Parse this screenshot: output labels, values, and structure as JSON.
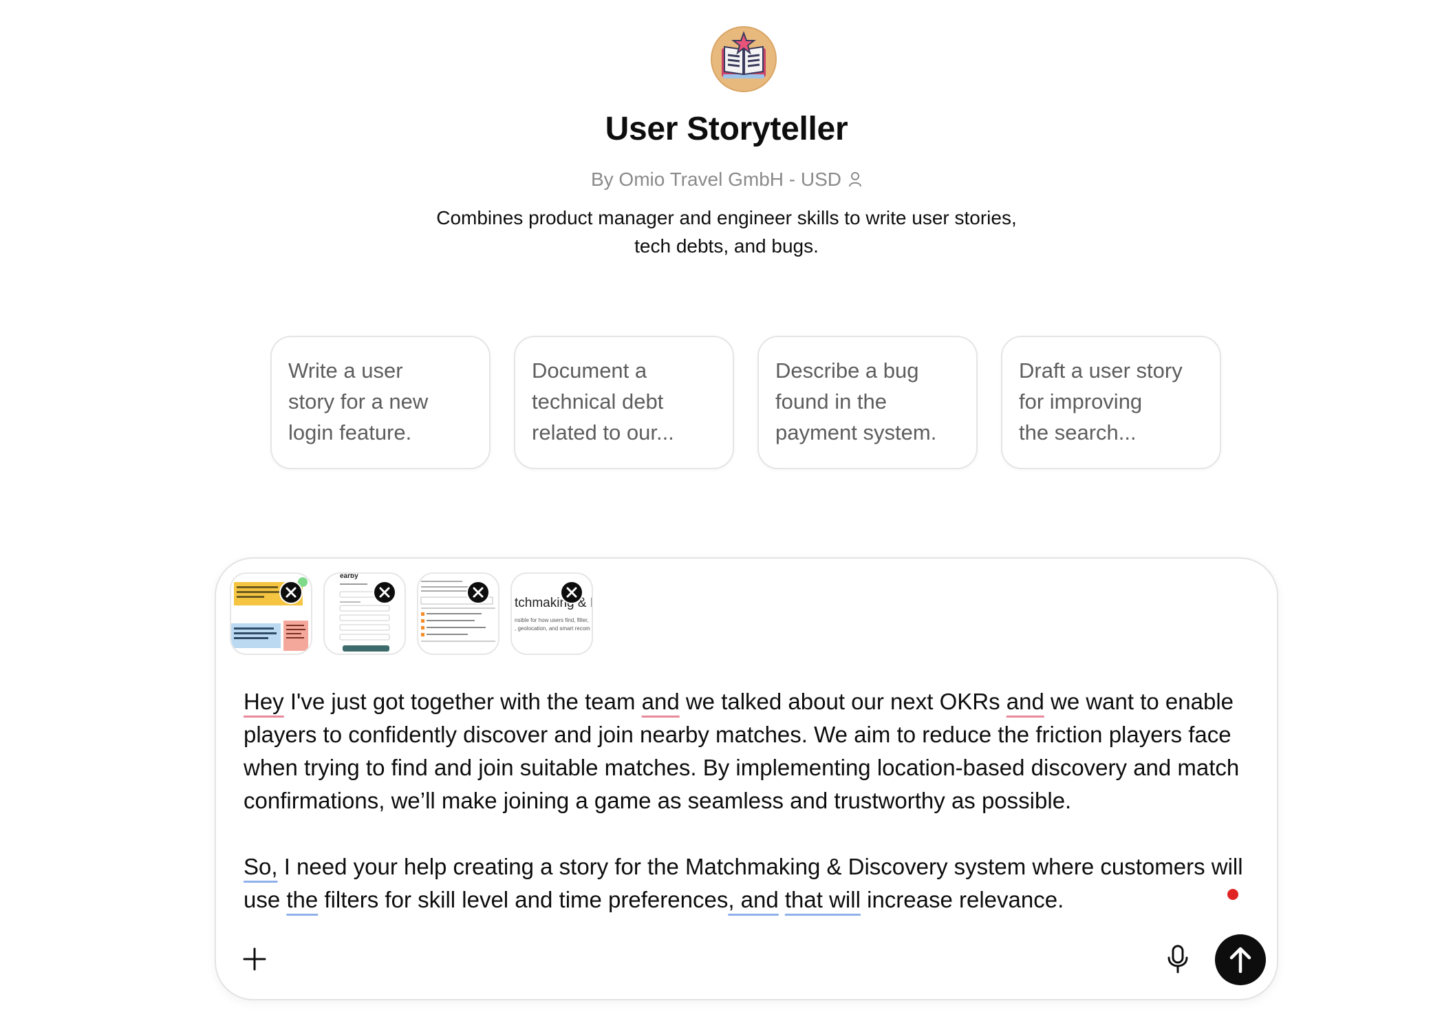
{
  "gpt": {
    "avatar_icon": "book-star-icon",
    "name": "User Storyteller",
    "byline": "By Omio Travel GmbH - USD",
    "byline_icon": "person-icon",
    "description_line1": "Combines product manager and engineer skills to write user stories,",
    "description_line2": "tech debts, and bugs."
  },
  "starters": [
    {
      "line1": "Write a user",
      "line2": "story for a new",
      "line3": "login feature."
    },
    {
      "line1": "Document a",
      "line2": "technical debt",
      "line3": "related to our..."
    },
    {
      "line1": "Describe a bug",
      "line2": "found in the",
      "line3": "payment system."
    },
    {
      "line1": "Draft a user story",
      "line2": "for improving",
      "line3": "the search..."
    }
  ],
  "attachments": [
    {
      "kind": "image",
      "remove_icon": "close-icon"
    },
    {
      "kind": "image",
      "label": "earby",
      "remove_icon": "close-icon"
    },
    {
      "kind": "image",
      "remove_icon": "close-icon"
    },
    {
      "kind": "image",
      "label": "tchmaking & D",
      "sublabel1": "nsible for how users find, filter,",
      "sublabel2": ", geolocation, and smart recom",
      "remove_icon": "close-icon"
    }
  ],
  "message": {
    "p1": {
      "w_hey": "Hey",
      "t1": " I've just got together with the team ",
      "w_and1": "and",
      "t2": " we talked about our next OKRs ",
      "w_and2": "and",
      "t3": " we want to enable players to confidently discover and join nearby matches. We aim to reduce the friction players face when trying to find and join suitable matches. By implementing location-based discovery and match confirmations, we’ll make joining a game as seamless and trustworthy as possible."
    },
    "p2": {
      "w_so": "So,",
      "t1": " I need your help creating a story for the Matchmaking & Discovery system where customers will use ",
      "w_the": "the",
      "t2": " filters for skill level and time preferences",
      "w_and": ", and",
      "t3": " ",
      "w_thatwill": "that will",
      "t4": " increase relevance."
    }
  },
  "composer": {
    "add_icon": "plus-icon",
    "mic_icon": "microphone-icon",
    "send_icon": "arrow-up-icon",
    "recording_indicator_color": "#e02424"
  }
}
